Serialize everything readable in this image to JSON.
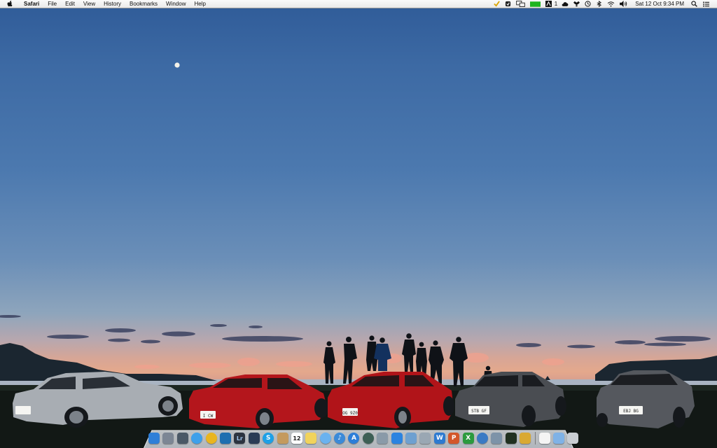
{
  "menubar": {
    "app_name": "Safari",
    "menus": [
      "File",
      "Edit",
      "View",
      "History",
      "Bookmarks",
      "Window",
      "Help"
    ],
    "status_icons": [
      "checkmark-icon",
      "shield-icon",
      "display-mirror-icon",
      "battery-green-icon",
      "adobe-icon",
      "cloud-icon",
      "dropbox-icon",
      "time-machine-icon",
      "bluetooth-icon",
      "wifi-icon",
      "volume-icon"
    ],
    "adobe_count": "1",
    "date_time": "Sat 12 Oct  9:34 PM"
  },
  "wallpaper": {
    "license_plates": [
      "I CW",
      "OG 9Z0",
      "STB GF",
      "EBJ BG"
    ],
    "colors": {
      "sky_top": "#2f5b98",
      "horizon": "#e4a88c",
      "car_silver": "#a8adb3",
      "car_red": "#b4161c",
      "car_dark": "#4a4d52"
    }
  },
  "dock": {
    "apps": [
      {
        "name": "Finder",
        "icon": "finder-icon",
        "color": "#2f7fd8",
        "glyph": ""
      },
      {
        "name": "Launchpad",
        "icon": "launchpad-icon",
        "color": "#7c8694",
        "glyph": ""
      },
      {
        "name": "Mission Control",
        "icon": "mission-control-icon",
        "color": "#4a5866",
        "glyph": ""
      },
      {
        "name": "Safari",
        "icon": "safari-icon",
        "color": "#3ea0ea",
        "glyph": ""
      },
      {
        "name": "Chrome",
        "icon": "chrome-icon",
        "color": "#e9b51f",
        "glyph": ""
      },
      {
        "name": "Photoshop",
        "icon": "photoshop-icon",
        "color": "#1d6fb0",
        "glyph": ""
      },
      {
        "name": "Lightroom",
        "icon": "lightroom-icon",
        "color": "#2c3440",
        "glyph": "Lr"
      },
      {
        "name": "Kindle",
        "icon": "kindle-icon",
        "color": "#2a3c55",
        "glyph": ""
      },
      {
        "name": "Skype",
        "icon": "skype-icon",
        "color": "#1da0e6",
        "glyph": "S"
      },
      {
        "name": "Contacts",
        "icon": "contacts-icon",
        "color": "#c49a5e",
        "glyph": ""
      },
      {
        "name": "Calendar",
        "icon": "calendar-icon",
        "color": "#ffffff",
        "glyph": "12"
      },
      {
        "name": "Notes",
        "icon": "notes-icon",
        "color": "#f1d35b",
        "glyph": ""
      },
      {
        "name": "Messages",
        "icon": "messages-icon",
        "color": "#6ab2ef",
        "glyph": ""
      },
      {
        "name": "iTunes",
        "icon": "itunes-icon",
        "color": "#3b8ad8",
        "glyph": "♪"
      },
      {
        "name": "App Store",
        "icon": "app-store-icon",
        "color": "#2b7ed8",
        "glyph": "A"
      },
      {
        "name": "Time Machine",
        "icon": "time-machine-dock-icon",
        "color": "#3d5f55",
        "glyph": ""
      },
      {
        "name": "Preview",
        "icon": "preview-icon",
        "color": "#8a9aa8",
        "glyph": ""
      },
      {
        "name": "iCloud",
        "icon": "icloud-icon",
        "color": "#2b83e0",
        "glyph": ""
      },
      {
        "name": "Image Capture",
        "icon": "image-capture-icon",
        "color": "#6ea0d0",
        "glyph": ""
      },
      {
        "name": "Mail",
        "icon": "mail-icon",
        "color": "#9aa7b3",
        "glyph": ""
      },
      {
        "name": "Word",
        "icon": "word-icon",
        "color": "#2d7ad0",
        "glyph": "W"
      },
      {
        "name": "PowerPoint",
        "icon": "powerpoint-icon",
        "color": "#d3572a",
        "glyph": "P"
      },
      {
        "name": "Excel",
        "icon": "excel-icon",
        "color": "#2b9a3e",
        "glyph": "X"
      },
      {
        "name": "Google Earth",
        "icon": "google-earth-icon",
        "color": "#3a7ac4",
        "glyph": ""
      },
      {
        "name": "Migration",
        "icon": "migration-icon",
        "color": "#7d93a8",
        "glyph": ""
      },
      {
        "name": "Activity Monitor",
        "icon": "activity-monitor-icon",
        "color": "#203020",
        "glyph": ""
      },
      {
        "name": "Script",
        "icon": "script-icon",
        "color": "#d9a933",
        "glyph": ""
      }
    ],
    "right_items": [
      {
        "name": "Document",
        "icon": "document-icon",
        "color": "#f4f4f4"
      },
      {
        "name": "Folder",
        "icon": "folder-icon",
        "color": "#7fb2e6"
      },
      {
        "name": "Trash",
        "icon": "trash-icon",
        "color": "#c9cdd2"
      }
    ]
  }
}
